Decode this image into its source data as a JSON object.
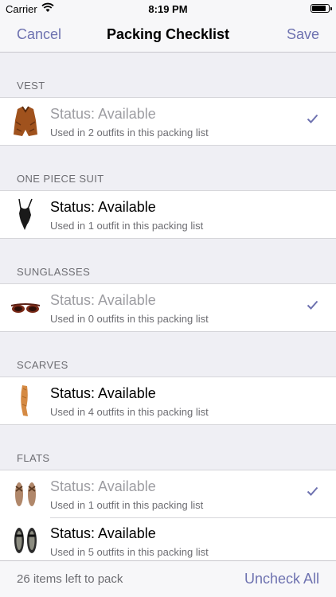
{
  "status_bar": {
    "carrier": "Carrier",
    "time": "8:19 PM"
  },
  "nav": {
    "cancel": "Cancel",
    "title": "Packing Checklist",
    "save": "Save"
  },
  "sections": [
    {
      "header": "VEST",
      "items": [
        {
          "title": "Status: Available",
          "subtitle": "Used in 2 outfits in this packing list",
          "checked": true,
          "thumb_icon": "vest-icon"
        }
      ]
    },
    {
      "header": "ONE PIECE SUIT",
      "items": [
        {
          "title": "Status: Available",
          "subtitle": "Used in 1 outfit in this packing list",
          "checked": false,
          "thumb_icon": "swimsuit-icon"
        }
      ]
    },
    {
      "header": "SUNGLASSES",
      "items": [
        {
          "title": "Status: Available",
          "subtitle": "Used in 0 outfits in this packing list",
          "checked": true,
          "thumb_icon": "sunglasses-icon"
        }
      ]
    },
    {
      "header": "SCARVES",
      "items": [
        {
          "title": "Status: Available",
          "subtitle": "Used in 4 outfits in this packing list",
          "checked": false,
          "thumb_icon": "scarf-icon"
        }
      ]
    },
    {
      "header": "FLATS",
      "items": [
        {
          "title": "Status: Available",
          "subtitle": "Used in 1 outfit in this packing list",
          "checked": true,
          "thumb_icon": "sandals-icon"
        },
        {
          "title": "Status: Available",
          "subtitle": "Used in 5 outfits in this packing list",
          "checked": false,
          "thumb_icon": "flats-icon"
        }
      ]
    }
  ],
  "toolbar": {
    "remaining": "26 items left to pack",
    "uncheck_all": "Uncheck All"
  },
  "colors": {
    "accent": "#6e72b0",
    "background": "#efeff4",
    "checked_text": "#9d9da2"
  }
}
